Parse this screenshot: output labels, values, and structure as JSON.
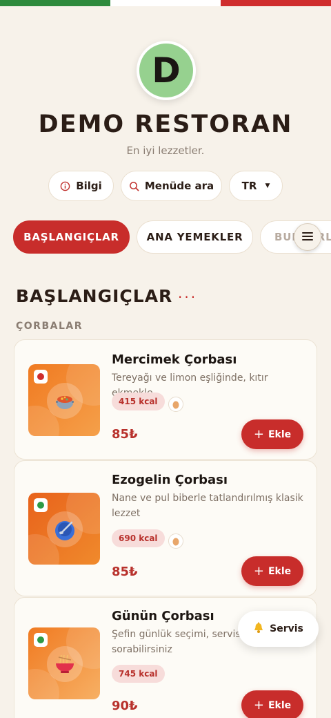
{
  "header": {
    "logo_letter": "D",
    "title": "DEMO RESTORAN",
    "subtitle": "En iyi lezzetler.",
    "info_label": "Bilgi",
    "search_label": "Menüde ara",
    "language": "TR"
  },
  "tabs": [
    {
      "label": "BAŞLANGIÇLAR",
      "active": true
    },
    {
      "label": "ANA YEMEKLER",
      "active": false
    },
    {
      "label": "BURGERLER",
      "active": false
    }
  ],
  "section": {
    "title": "BAŞLANGIÇLAR",
    "dots": "···",
    "subcategory": "ÇORBALAR"
  },
  "items": [
    {
      "name": "Mercimek Çorbası",
      "description": "Tereyağı ve limon eşliğinde, kıtır ekmekle",
      "kcal": "415 kcal",
      "price": "85₺",
      "add_label": "Ekle",
      "veg_color": "#cf2d2d",
      "icon": "soup-pot-icon"
    },
    {
      "name": "Ezogelin Çorbası",
      "description": "Nane ve pul biberle tatlandırılmış klasik lezzet",
      "kcal": "690 kcal",
      "price": "85₺",
      "add_label": "Ekle",
      "veg_color": "#2e9a45",
      "icon": "bowl-spoon-icon"
    },
    {
      "name": "Günün Çorbası",
      "description": "Şefin günlük seçimi, servis personeline sorabilirsiniz",
      "kcal": "745 kcal",
      "price": "90₺",
      "add_label": "Ekle",
      "veg_color": "#2e9a45",
      "icon": "noodle-bowl-icon"
    }
  ],
  "service_button": {
    "label": "Servis",
    "icon": "bell-icon"
  },
  "colors": {
    "accent": "#c82d2b",
    "background": "#f7f2ea",
    "logo_bg": "#96d18f"
  }
}
